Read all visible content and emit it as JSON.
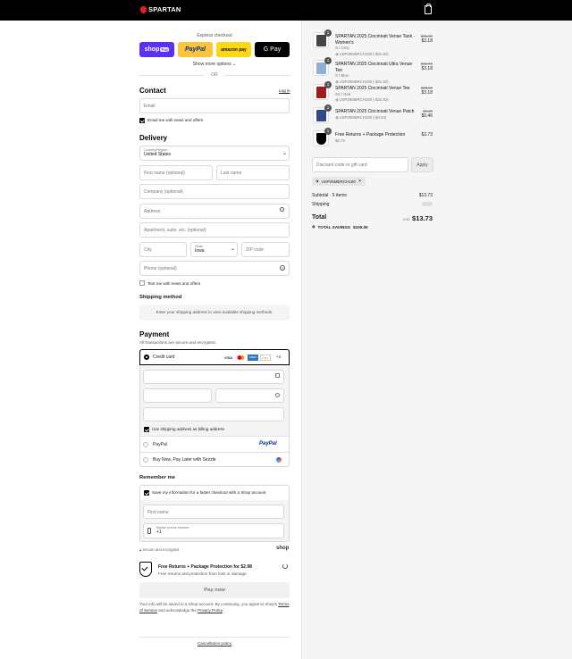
{
  "header": {
    "brand": "SPARTAN"
  },
  "express": {
    "title": "Express checkout",
    "more": "Show more options",
    "or": "OR",
    "buttons": {
      "shop": "shop",
      "shop_pay": "Pay",
      "paypal": "PayPal",
      "amazon": "amazon pay",
      "gpay": "G Pay"
    }
  },
  "contact": {
    "heading": "Contact",
    "login": "Log in",
    "email_placeholder": "Email",
    "news_label": "Email me with news and offers"
  },
  "delivery": {
    "heading": "Delivery",
    "country_label": "Country/Region",
    "country_value": "United States",
    "first_name": "First name (optional)",
    "last_name": "Last name",
    "company": "Company (optional)",
    "address": "Address",
    "apartment": "Apartment, suite, etc. (optional)",
    "city": "City",
    "state_label": "State",
    "state_value": "Iowa",
    "zip": "ZIP code",
    "phone": "Phone (optional)",
    "text_label": "Text me with news and offers"
  },
  "shipping": {
    "heading": "Shipping method",
    "notice": "Enter your shipping address to view available shipping methods."
  },
  "payment": {
    "heading": "Payment",
    "subtitle": "All transactions are secure and encrypted.",
    "credit_card": "Credit card",
    "card_brands": [
      "VISA",
      "MC",
      "AMEX",
      "DISC"
    ],
    "more_cards": "+4",
    "billing_label": "Use shipping address as billing address",
    "paypal": "PayPal",
    "paypal_logo": "PayPal",
    "sezzle": "Buy Now, Pay Later with Sezzle"
  },
  "remember": {
    "heading": "Remember me",
    "save_label": "Save my information for a faster checkout with a Shop account",
    "first_name": "First name",
    "phone_label": "Mobile phone number",
    "phone_value": "+1",
    "secure": "Secure and encrypted",
    "shop": "shop"
  },
  "protection": {
    "title": "Free Returns + Package Protection for $2.98",
    "desc": "Free returns and protection from loss or damage."
  },
  "pay_now": "Pay now",
  "legal": {
    "text": "Your info will be saved to a Shop account. By continuing, you agree to Shop's",
    "terms": "Terms of Service",
    "and": "and acknowledge the",
    "privacy": "Privacy Policy",
    "end": "."
  },
  "footer": {
    "cancellation": "Cancellation policy"
  },
  "cart": {
    "items": [
      {
        "name": "SPARTAN 2025 Cincinnati Venue Tank - Women's",
        "variant": "S / Grey",
        "discount": "USP25MERCH100 (-$31.82)",
        "was": "$35.00",
        "price": "$3.18",
        "qty": "1",
        "color": "#444"
      },
      {
        "name": "SPARTAN 2025 Cincinnati Ultra Venue Tee",
        "variant": "S / Blue",
        "discount": "USP25MERCH100 (-$31.82)",
        "was": "$35.00",
        "price": "$3.18",
        "qty": "1",
        "color": "#8fb0d8"
      },
      {
        "name": "SPARTAN 2025 Cincinnati Venue Tee",
        "variant": "XS / Red",
        "discount": "USP25MERCH100 (-$31.82)",
        "was": "$35.00",
        "price": "$3.18",
        "qty": "1",
        "color": "#9b1b1e"
      },
      {
        "name": "SPARTAN 2025 Cincinnati Venue Patch",
        "variant": "",
        "discount": "USP25MERCH100 (-$4.54)",
        "was": "$5.00",
        "price": "$0.46",
        "qty": "1",
        "color": "#334a8a"
      },
      {
        "name": "Free Returns + Package Protection",
        "variant": "$3.73",
        "discount": "",
        "was": "",
        "price": "$3.73",
        "qty": "1",
        "color": "#000"
      }
    ],
    "discount_placeholder": "Discount code or gift card",
    "apply": "Apply",
    "code": "USP25MERCH100",
    "subtotal_label": "Subtotal · 5 items",
    "subtotal": "$13.73",
    "shipping_label": "Shipping",
    "total_label": "Total",
    "currency": "USD",
    "total": "$13.73",
    "savings_label": "TOTAL SAVINGS",
    "savings": "$100.00"
  }
}
